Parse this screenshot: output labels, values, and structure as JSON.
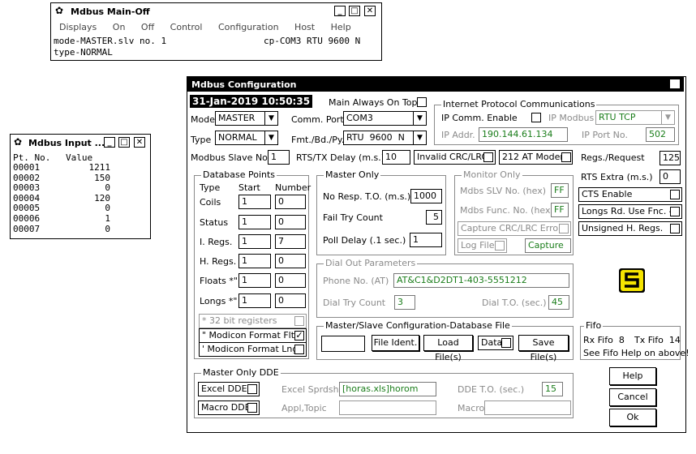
{
  "main_window": {
    "title": "Mdbus Main-Off",
    "menu": [
      "Displays",
      "On",
      "Off",
      "Control",
      "Configuration",
      "Host",
      "Help"
    ],
    "line1_left": "mode-MASTER.slv no. 1",
    "line1_right": "cp-COM3 RTU 9600 N",
    "line2": "type-NORMAL"
  },
  "input_window": {
    "title": "Mdbus Input ...",
    "header_pt": "Pt. No.",
    "header_value": "Value",
    "rows": [
      {
        "pt": "00001",
        "value": "1211"
      },
      {
        "pt": "00002",
        "value": "150"
      },
      {
        "pt": "00003",
        "value": "0"
      },
      {
        "pt": "00004",
        "value": "120"
      },
      {
        "pt": "00005",
        "value": "0"
      },
      {
        "pt": "00006",
        "value": "1"
      },
      {
        "pt": "00007",
        "value": "0"
      }
    ]
  },
  "config": {
    "title": "Mdbus Configuration",
    "datetime": "31-Jan-2019 10:50:35",
    "main_always_on_top": "Main Always On Top",
    "mode_label": "Mode",
    "mode_value": "MASTER",
    "type_label": "Type",
    "type_value": "NORMAL",
    "comm_port_label": "Comm. Port",
    "comm_port_value": "COM3",
    "fmt_label": "Fmt./Bd./Py.",
    "fmt_value": "RTU  9600  N",
    "ip": {
      "group": "Internet Protocol Communications",
      "enable": "IP Comm. Enable",
      "modbus_label": "IP Modbus",
      "modbus_value": "RTU TCP",
      "addr_label": "IP Addr.",
      "addr_value": "190.144.61.134",
      "port_label": "IP Port No.",
      "port_value": "502"
    },
    "slave_no_label": "Modbus Slave No.",
    "slave_no_value": "1",
    "rts_delay_label": "RTS/TX Delay (m.s.)",
    "rts_delay_value": "10",
    "invalid_crc": "Invalid CRC/LRC",
    "at_modem": "212 AT Modem",
    "regs_request_label": "Regs./Request",
    "regs_request_value": "125",
    "rts_extra_label": "RTS Extra (m.s.)",
    "rts_extra_value": "0",
    "cts_enable": "CTS Enable",
    "longs_rd": "Longs Rd. Use Fnc. 4",
    "unsigned_h_regs": "Unsigned H. Regs.",
    "db": {
      "group": "Database Points",
      "col_type": "Type",
      "col_start": "Start",
      "col_number": "Number",
      "rows": [
        {
          "type": "Coils",
          "start": "1",
          "number": "0"
        },
        {
          "type": "Status",
          "start": "1",
          "number": "0"
        },
        {
          "type": "I. Regs.",
          "start": "1",
          "number": "7"
        },
        {
          "type": "H. Regs.",
          "start": "1",
          "number": "0"
        },
        {
          "type": "Floats *\"",
          "start": "1",
          "number": "0"
        },
        {
          "type": "Longs *\"",
          "start": "1",
          "number": "0"
        }
      ],
      "note_32bit": "* 32 bit registers",
      "modicon_flt": "\" Modicon Format Flt.",
      "modicon_flt_checked": "✓",
      "modicon_lng": "' Modicon Format Lng."
    },
    "master_only": {
      "group": "Master Only",
      "no_resp_label": "No Resp. T.O. (m.s.)",
      "no_resp_value": "1000",
      "fail_try_label": "Fail Try Count",
      "fail_try_value": "5",
      "poll_delay_label": "Poll Delay (.1 sec.)",
      "poll_delay_value": "1"
    },
    "monitor_only": {
      "group": "Monitor Only",
      "slv_label": "Mdbs SLV No. (hex)",
      "slv_value": "FF",
      "func_label": "Mdbs Func. No. (hex)",
      "func_value": "FF",
      "capture_crc": "Capture CRC/LRC Error",
      "log_file": "Log File",
      "capture": "Capture"
    },
    "dial_out": {
      "group": "Dial Out Parameters",
      "phone_label": "Phone No. (AT)",
      "phone_value": "AT&C1&D2DT1-403-5551212",
      "dial_try_label": "Dial Try Count",
      "dial_try_value": "3",
      "dial_to_label": "Dial T.O. (sec.)",
      "dial_to_value": "45"
    },
    "file_cfg": {
      "group": "Master/Slave Configuration-Database File",
      "file_value": "",
      "file_ident": "File Ident.",
      "load": "Load File(s)",
      "data": "Data",
      "save": "Save File(s)"
    },
    "fifo": {
      "group": "Fifo",
      "rx": "Rx Fifo  8",
      "tx": "Tx Fifo  14",
      "help": "See Fifo Help on above!"
    },
    "dde": {
      "group": "Master Only DDE",
      "excel_dde": "Excel DDE",
      "excel_sprdsht_label": "Excel Sprdsht",
      "excel_sprdsht_value": "[horas.xls]horom",
      "dde_to_label": "DDE T.O. (sec.)",
      "dde_to_value": "15",
      "macro_dde": "Macro DDE",
      "appl_topic_label": "Appl,Topic",
      "appl_topic_value": "",
      "macro_label": "Macro",
      "macro_value": ""
    },
    "help_button": "Help",
    "cancel_button": "Cancel",
    "ok_button": "Ok",
    "accent_green": "#1a7d1a",
    "logo_yellow": "#f5e400"
  }
}
